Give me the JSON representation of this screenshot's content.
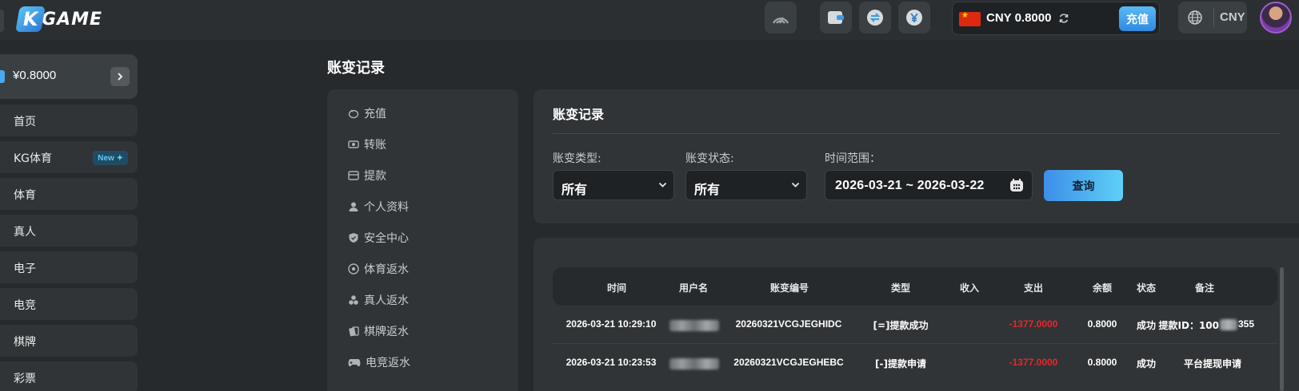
{
  "header": {
    "logo_text": "GAME",
    "logo_letter": "K",
    "wallet": {
      "currency_amount": "CNY 0.8000",
      "recharge_label": "充值"
    },
    "currency": "CNY"
  },
  "sidebar": {
    "balance": "¥0.8000",
    "items": [
      {
        "label": "首页"
      },
      {
        "label": "KG体育",
        "badge": "New"
      },
      {
        "label": "体育"
      },
      {
        "label": "真人"
      },
      {
        "label": "电子"
      },
      {
        "label": "电竞"
      },
      {
        "label": "棋牌"
      },
      {
        "label": "彩票"
      }
    ]
  },
  "page": {
    "title": "账变记录"
  },
  "account_menu": {
    "items": [
      {
        "label": "充值",
        "icon": "piggy-bank-icon"
      },
      {
        "label": "转账",
        "icon": "transfer-icon"
      },
      {
        "label": "提款",
        "icon": "withdraw-icon"
      },
      {
        "label": "个人资料",
        "icon": "user-icon"
      },
      {
        "label": "安全中心",
        "icon": "shield-icon"
      },
      {
        "label": "体育返水",
        "icon": "football-icon"
      },
      {
        "label": "真人返水",
        "icon": "chips-icon"
      },
      {
        "label": "棋牌返水",
        "icon": "cards-icon"
      },
      {
        "label": "电竞返水",
        "icon": "gamepad-icon"
      }
    ]
  },
  "filter": {
    "title": "账变记录",
    "type_label": "账变类型:",
    "type_value": "所有",
    "status_label": "账变状态:",
    "status_value": "所有",
    "range_label": "时间范围：",
    "range_value": "2026-03-21 ~ 2026-03-22",
    "query_label": "查询"
  },
  "table": {
    "columns": [
      "时间",
      "用户名",
      "账变编号",
      "类型",
      "收入",
      "支出",
      "余额",
      "状态",
      "备注"
    ],
    "rows": [
      {
        "time": "2026-03-21 10:29:10",
        "order": "20260321VCGJEGHIDC",
        "type": "[=]提款成功",
        "income": "",
        "expense": "-1377.0000",
        "balance": "0.8000",
        "status": "成功",
        "note_prefix": "提款ID：100",
        "note_suffix": "355"
      },
      {
        "time": "2026-03-21 10:23:53",
        "order": "20260321VCGJEGHEBC",
        "type": "[-]提款申请",
        "income": "",
        "expense": "-1377.0000",
        "balance": "0.8000",
        "status": "成功",
        "note_prefix": "平台提现申请",
        "note_suffix": ""
      }
    ]
  },
  "colors": {
    "accent": "#3d8ee8",
    "negative": "#e8262b",
    "panel": "#303436",
    "background": "#262a2c"
  }
}
